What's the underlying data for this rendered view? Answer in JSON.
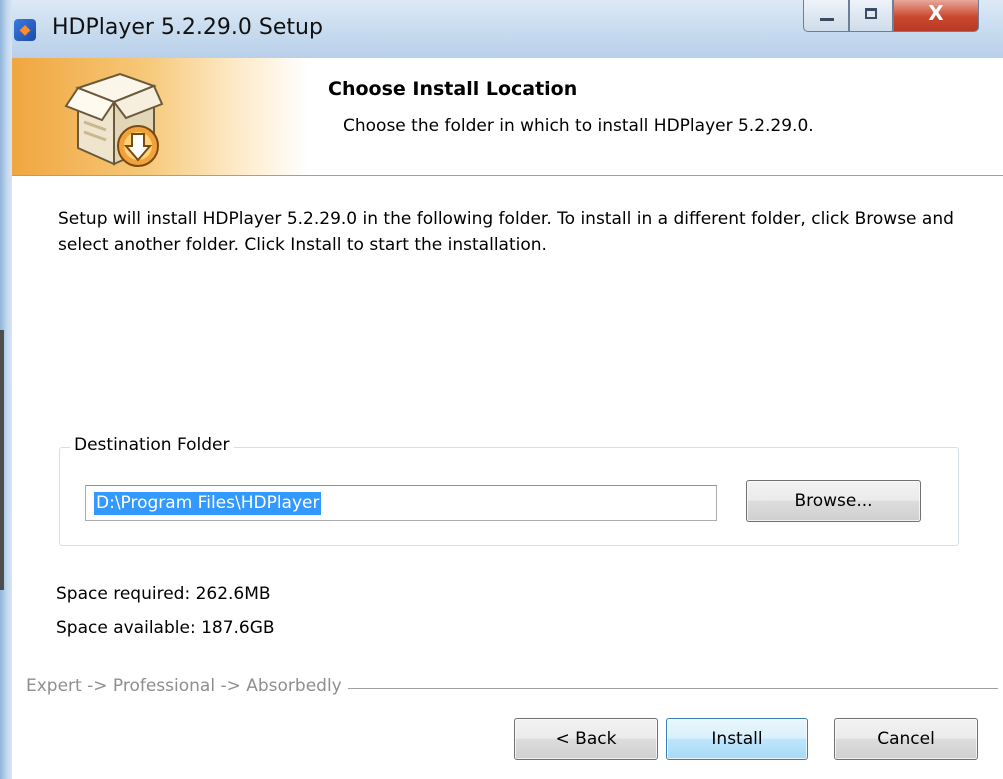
{
  "window": {
    "title": "HDPlayer 5.2.29.0 Setup",
    "close_glyph": "X"
  },
  "header": {
    "title": "Choose Install Location",
    "subtitle": "Choose the folder in which to install HDPlayer 5.2.29.0."
  },
  "main": {
    "intro": "Setup will install HDPlayer 5.2.29.0 in the following folder. To install in a different folder, click Browse and select another folder. Click Install to start the installation.",
    "destination_label": "Destination Folder",
    "destination_path": "D:\\Program Files\\HDPlayer",
    "browse_label": "Browse...",
    "space_required": "Space required: 262.6MB",
    "space_available": "Space available: 187.6GB"
  },
  "footer": {
    "branding": "Expert -> Professional -> Absorbedly",
    "back_label": "< Back",
    "install_label": "Install",
    "cancel_label": "Cancel"
  },
  "icons": {
    "app": "hdplayer-app-icon",
    "header": "install-box-icon"
  },
  "colors": {
    "selection": "#3399ff",
    "header_art": "#f0a640"
  }
}
